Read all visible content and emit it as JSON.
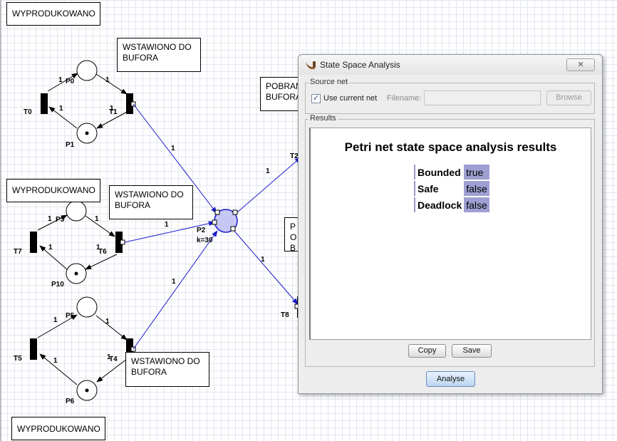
{
  "canvas": {
    "notes": {
      "wyprodukowano_top": "WYPRODUKOWANO",
      "wstawiono_top": "WSTAWIONO DO BUFORA",
      "pobrano": "POBRANO DO BUFORA",
      "wyprodukowano_mid": "WYPRODUKOWANO",
      "wstawiono_mid": "WSTAWIONO DO BUFORA",
      "po_partial": "PO BU",
      "wstawiono_bottom": "WSTAWIONO DO BUFORA",
      "wyprodukowano_bottom": "WYPRODUKOWANO"
    },
    "places": {
      "P0": "P0",
      "P1": "P1",
      "P2": "P2",
      "P2_capacity": "k=30",
      "P3": "P3",
      "P10": "P10",
      "P5": "P5",
      "P6": "P6"
    },
    "transitions": {
      "T0": "T0",
      "T1": "T1",
      "T2": "T2",
      "T7": "T7",
      "T6": "T6",
      "T5": "T5",
      "T4": "T4",
      "T8": "T8"
    },
    "arc_weight": "1"
  },
  "dialog": {
    "title": "State Space Analysis",
    "title_icon": "pipe-icon",
    "close_label": "✕",
    "source_net": {
      "group_title": "Source net",
      "use_current_label": "Use current net",
      "use_current_checked": true,
      "filename_label": "Filename:",
      "filename_value": "",
      "browse_label": "Browse"
    },
    "results": {
      "group_title": "Results",
      "heading": "Petri net state space analysis results",
      "rows": [
        {
          "name": "Bounded",
          "value": "true"
        },
        {
          "name": "Safe",
          "value": "false"
        },
        {
          "name": "Deadlock",
          "value": "false"
        }
      ],
      "copy_label": "Copy",
      "save_label": "Save"
    },
    "analyse_label": "Analyse"
  }
}
